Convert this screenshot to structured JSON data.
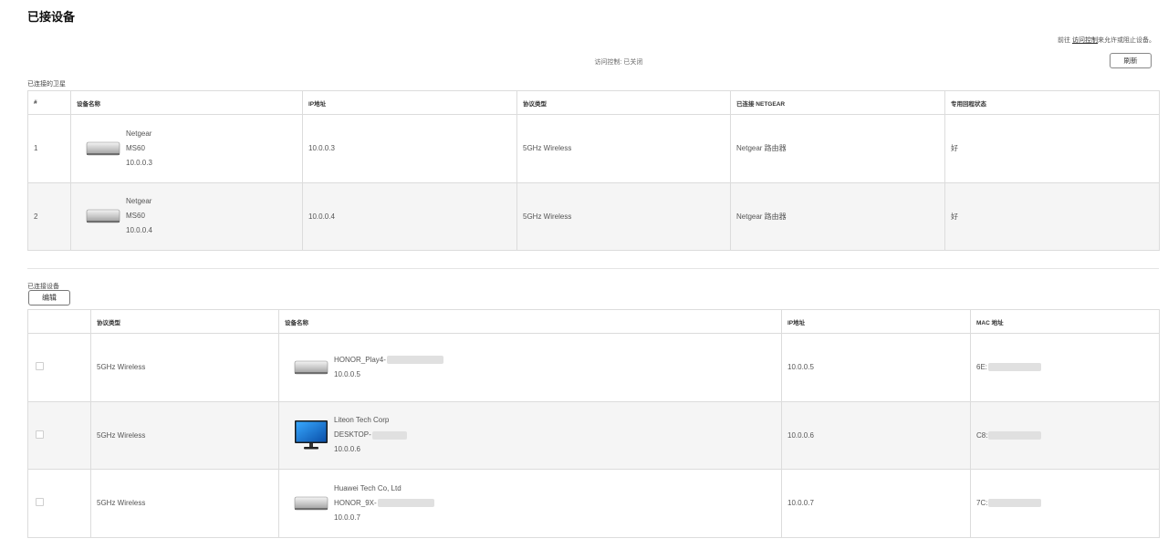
{
  "page": {
    "title": "已接设备"
  },
  "access": {
    "hint_prefix": "前往",
    "hint_link": "访问控制",
    "hint_suffix": "来允许或阻止设备。",
    "status": "访问控制: 已关闭",
    "refresh_label": "刷新"
  },
  "satellites": {
    "section_label": "已连接的卫星",
    "columns": {
      "index": "#",
      "name": "设备名称",
      "ip": "IP地址",
      "protocol": "协议类型",
      "connected": "已连接 NETGEAR",
      "backhaul": "专用回程状态"
    },
    "rows": [
      {
        "index": "1",
        "brand": "Netgear",
        "model": "MS60",
        "ip_sub": "10.0.0.3",
        "ip": "10.0.0.3",
        "protocol": "5GHz Wireless",
        "connected": "Netgear 路由器",
        "backhaul": "好"
      },
      {
        "index": "2",
        "brand": "Netgear",
        "model": "MS60",
        "ip_sub": "10.0.0.4",
        "ip": "10.0.0.4",
        "protocol": "5GHz Wireless",
        "connected": "Netgear 路由器",
        "backhaul": "好"
      }
    ]
  },
  "devices": {
    "section_label": "已连接设备",
    "edit_label": "编辑",
    "columns": {
      "select": "",
      "protocol": "协议类型",
      "name": "设备名称",
      "ip": "IP地址",
      "mac": "MAC 地址"
    },
    "rows": [
      {
        "protocol": "5GHz Wireless",
        "line1": "HONOR_Play4-",
        "line2": "10.0.0.5",
        "ip": "10.0.0.5",
        "mac": "6E:",
        "icon": "mini-pc-icon"
      },
      {
        "protocol": "5GHz Wireless",
        "line1": "Liteon Tech Corp",
        "line2": "DESKTOP-",
        "line3": "10.0.0.6",
        "ip": "10.0.0.6",
        "mac": "C8:",
        "icon": "monitor-icon"
      },
      {
        "protocol": "5GHz Wireless",
        "line1": "Huawei Tech Co, Ltd",
        "line2": "HONOR_9X-",
        "line3": "10.0.0.7",
        "ip": "10.0.0.7",
        "mac": "7C:",
        "icon": "mini-pc-icon"
      }
    ]
  }
}
